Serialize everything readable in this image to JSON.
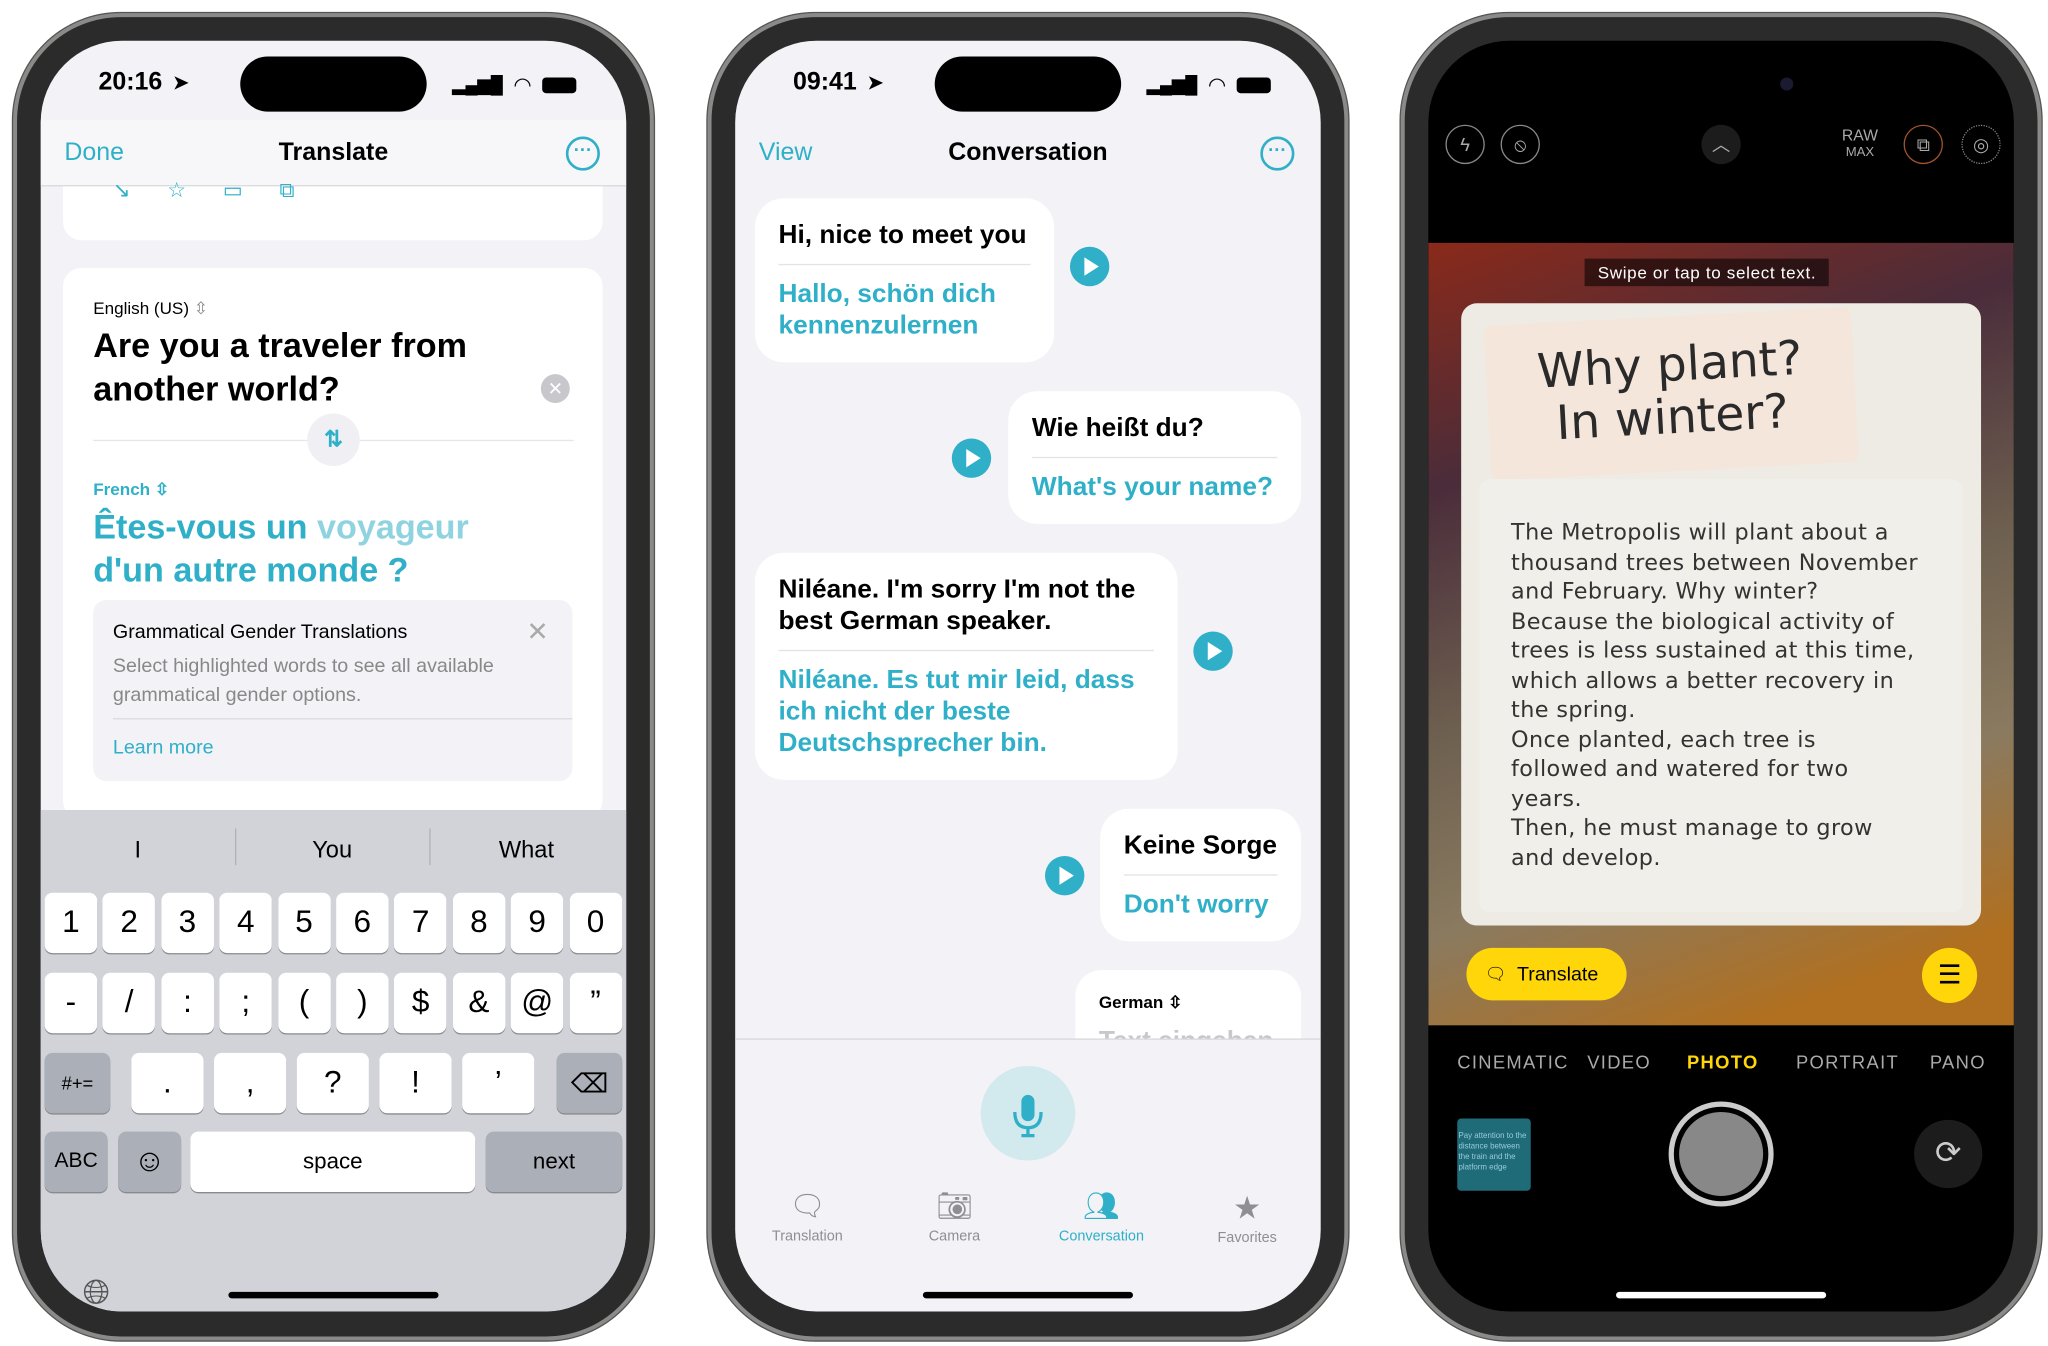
{
  "accent_color": "#2fb0c8",
  "phone1": {
    "status": {
      "time": "20:16"
    },
    "nav": {
      "done": "Done",
      "title": "Translate"
    },
    "source": {
      "language": "English (US)",
      "text": "Are you a traveler from another world?"
    },
    "target": {
      "language": "French",
      "text_part1": "Êtes-vous un ",
      "text_highlight": "voyageur",
      "text_part2": "d'un autre monde ?"
    },
    "gender_card": {
      "title": "Grammatical Gender Translations",
      "body": "Select highlighted words to see all available grammatical gender options.",
      "link": "Learn more"
    },
    "keyboard": {
      "suggestions": [
        "I",
        "You",
        "What"
      ],
      "row1": [
        "1",
        "2",
        "3",
        "4",
        "5",
        "6",
        "7",
        "8",
        "9",
        "0"
      ],
      "row2": [
        "-",
        "/",
        ":",
        ";",
        "(",
        ")",
        "$",
        "&",
        "@",
        "”"
      ],
      "row3": {
        "shift": "#+=",
        "keys": [
          ".",
          ",",
          "?",
          "!",
          "’"
        ]
      },
      "row4": {
        "abc": "ABC",
        "space": "space",
        "next": "next"
      }
    }
  },
  "phone2": {
    "status": {
      "time": "09:41"
    },
    "nav": {
      "view": "View",
      "title": "Conversation"
    },
    "messages": [
      {
        "original": "Hi, nice to meet you",
        "translation": "Hallo, schön dich kennenzulernen",
        "side": "left"
      },
      {
        "original": "Wie heißt du?",
        "translation": "What's your name?",
        "side": "right"
      },
      {
        "original": "Niléane. I'm sorry I'm not the best German speaker.",
        "translation": "Niléane. Es tut mir leid, dass ich nicht der beste Deutschsprecher bin.",
        "side": "left"
      },
      {
        "original": "Keine Sorge",
        "translation": "Don't worry",
        "side": "right"
      }
    ],
    "input_card": {
      "language": "German",
      "placeholder": "Text eingeben"
    },
    "tabs": [
      {
        "label": "Translation",
        "icon": "translate-icon"
      },
      {
        "label": "Camera",
        "icon": "camera-icon"
      },
      {
        "label": "Conversation",
        "icon": "people-icon",
        "active": true
      },
      {
        "label": "Favorites",
        "icon": "star-icon"
      }
    ]
  },
  "phone3": {
    "top": {
      "raw": "RAW",
      "max": "MAX"
    },
    "hint": "Swipe or tap to select text.",
    "sign_title": [
      "Why plant?",
      "In winter?"
    ],
    "sign_body": [
      "The Metropolis will plant about a",
      "thousand trees between November",
      "and February. Why winter?",
      "Because the biological activity of",
      "trees is less sustained at this time,",
      "which allows a better recovery in",
      "the spring.",
      "Once planted, each tree is",
      "followed and watered for two",
      "years.",
      "Then, he must manage to grow",
      "and develop."
    ],
    "translate_button": "Translate",
    "modes": [
      "CINEMATIC",
      "VIDEO",
      "PHOTO",
      "PORTRAIT",
      "PANO"
    ],
    "active_mode": "PHOTO",
    "thumbnail_text": "Pay attention to the distance between the train and the platform edge"
  }
}
